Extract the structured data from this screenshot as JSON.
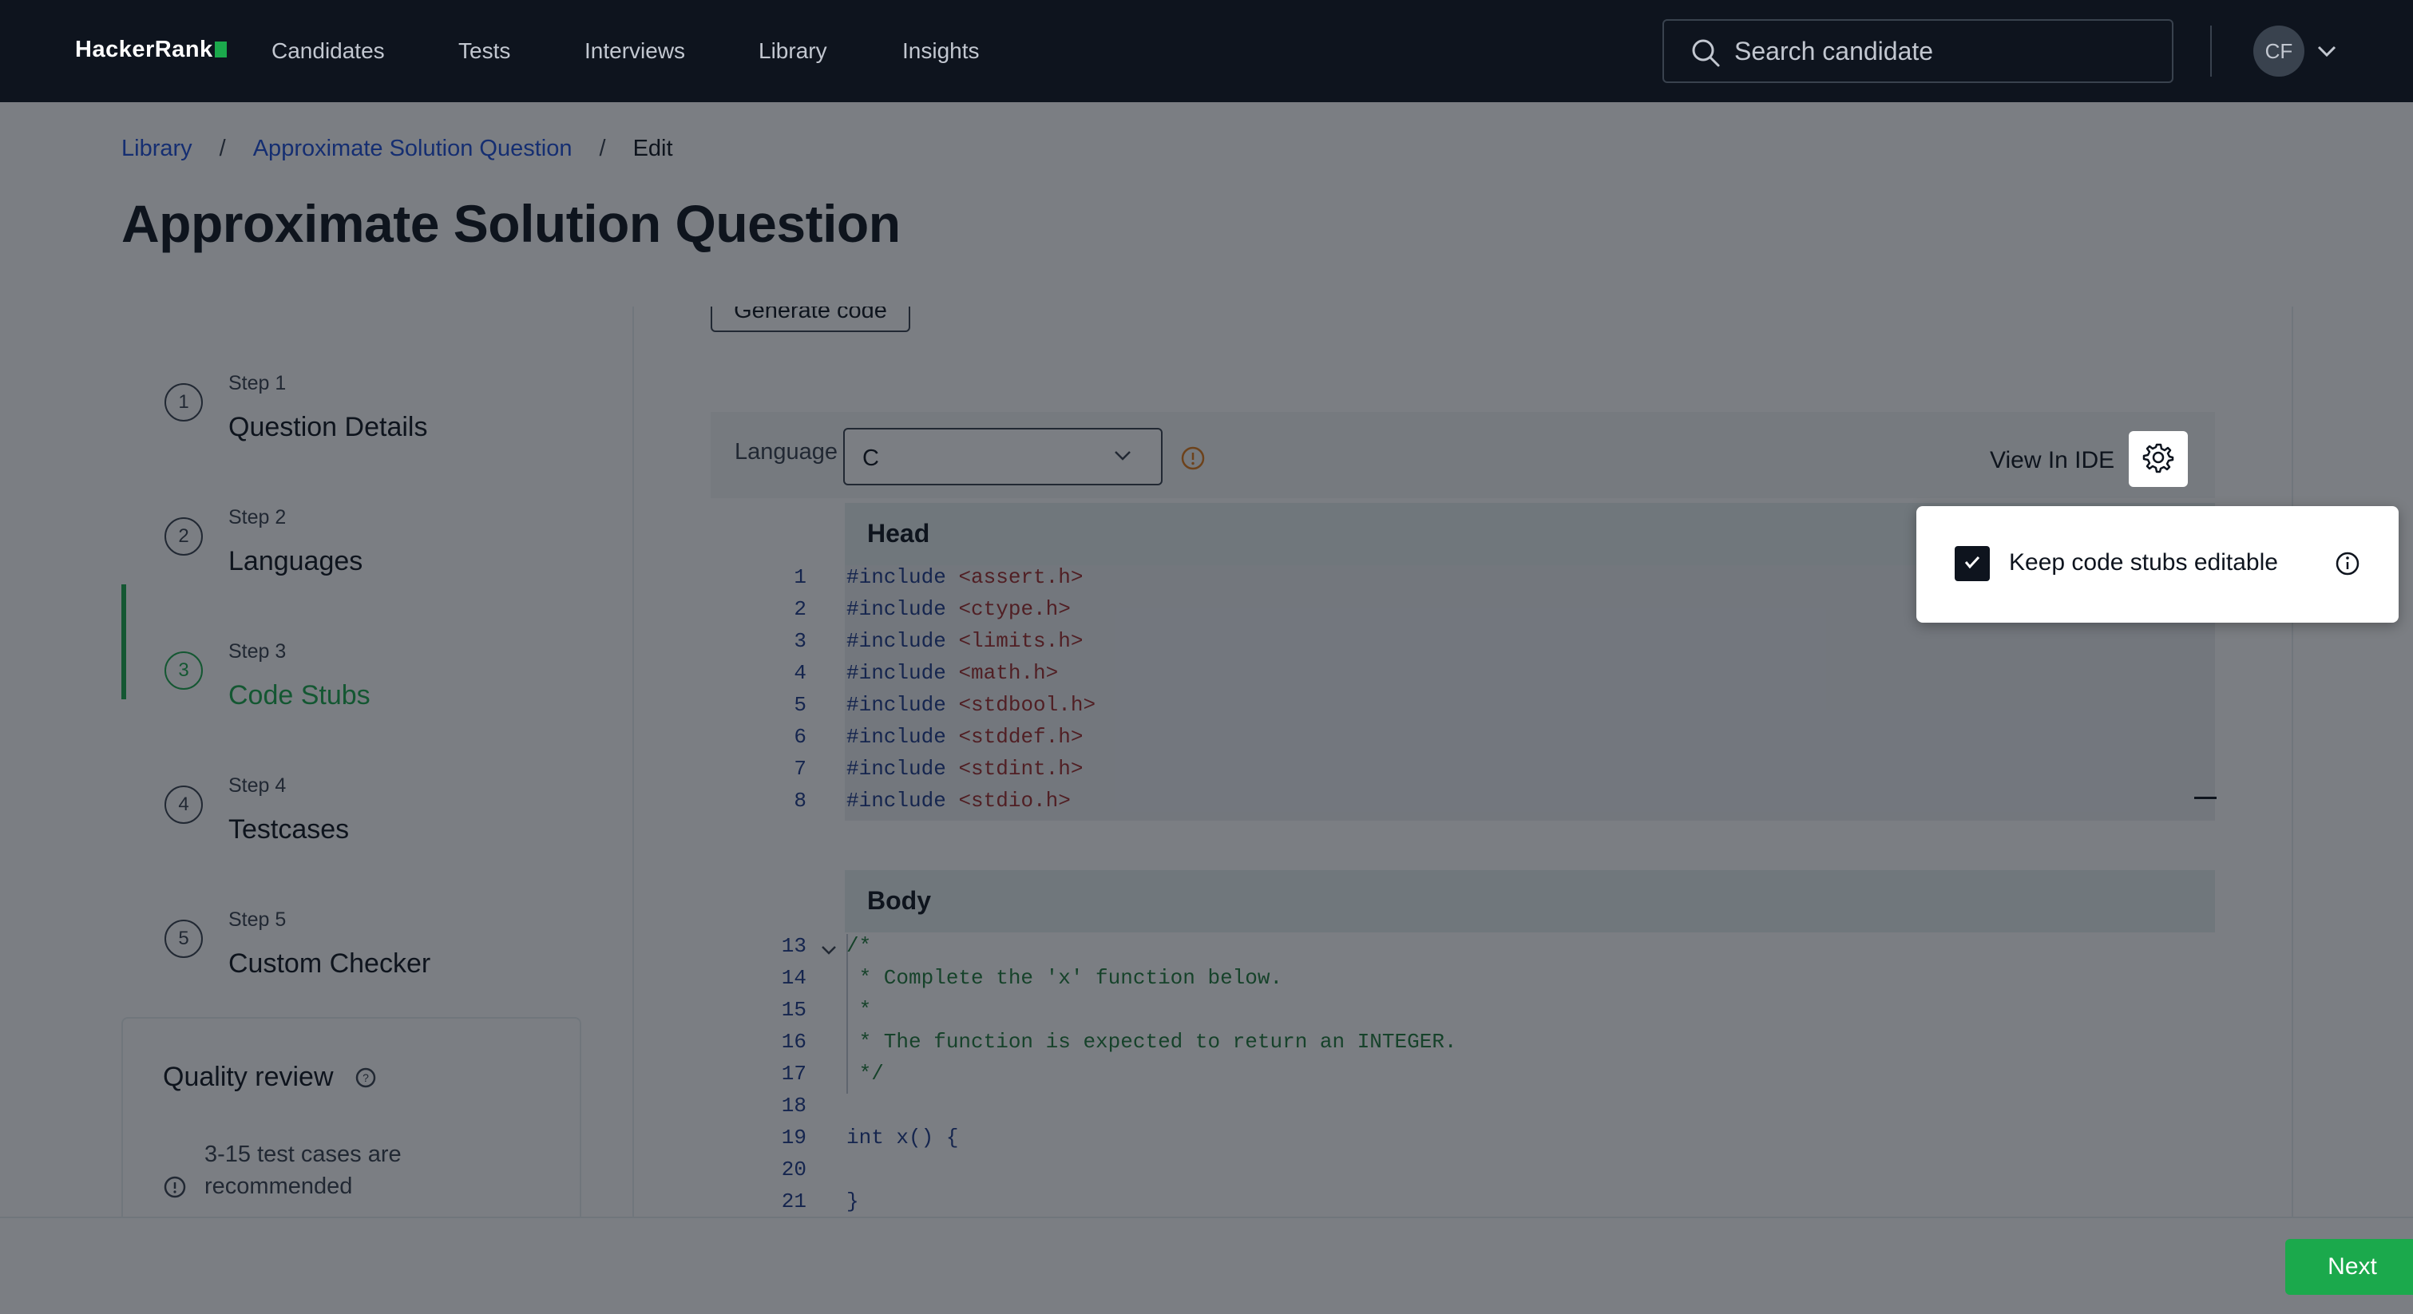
{
  "nav": {
    "logo": "HackerRank",
    "links": [
      "Candidates",
      "Tests",
      "Interviews",
      "Library",
      "Insights"
    ],
    "search_placeholder": "Search candidate",
    "avatar_initials": "CF",
    "colors": {
      "bg": "#0e141e",
      "brand": "#1ba94c"
    }
  },
  "breadcrumb": {
    "items": [
      "Library",
      "Approximate Solution Question",
      "Edit"
    ],
    "separator": "/"
  },
  "page_title": "Approximate Solution Question",
  "steps": [
    {
      "num": "1",
      "label": "Step 1",
      "title": "Question Details"
    },
    {
      "num": "2",
      "label": "Step 2",
      "title": "Languages"
    },
    {
      "num": "3",
      "label": "Step 3",
      "title": "Code Stubs"
    },
    {
      "num": "4",
      "label": "Step 4",
      "title": "Testcases"
    },
    {
      "num": "5",
      "label": "Step 5",
      "title": "Custom Checker"
    }
  ],
  "active_step": 3,
  "quality_review": {
    "title": "Quality review",
    "item": "3-15 test cases are recommended"
  },
  "editor": {
    "generate_button": "Generate code",
    "language_label": "Language",
    "language_value": "C",
    "view_in_ide": "View In IDE",
    "head_label": "Head",
    "body_label": "Body",
    "head_lines": [
      {
        "n": "1",
        "kw": "#include",
        "val": "<assert.h>"
      },
      {
        "n": "2",
        "kw": "#include",
        "val": "<ctype.h>"
      },
      {
        "n": "3",
        "kw": "#include",
        "val": "<limits.h>"
      },
      {
        "n": "4",
        "kw": "#include",
        "val": "<math.h>"
      },
      {
        "n": "5",
        "kw": "#include",
        "val": "<stdbool.h>"
      },
      {
        "n": "6",
        "kw": "#include",
        "val": "<stddef.h>"
      },
      {
        "n": "7",
        "kw": "#include",
        "val": "<stdint.h>"
      },
      {
        "n": "8",
        "kw": "#include",
        "val": "<stdio.h>"
      }
    ],
    "body_lines": [
      {
        "n": "13",
        "text": "/*"
      },
      {
        "n": "14",
        "text": " * Complete the 'x' function below."
      },
      {
        "n": "15",
        "text": " *"
      },
      {
        "n": "16",
        "text": " * The function is expected to return an INTEGER."
      },
      {
        "n": "17",
        "text": " */"
      },
      {
        "n": "18",
        "text": ""
      },
      {
        "n": "19",
        "text": "int x() {"
      },
      {
        "n": "20",
        "text": ""
      },
      {
        "n": "21",
        "text": "}"
      }
    ]
  },
  "popover": {
    "checkbox_label": "Keep code stubs editable",
    "checked": true
  },
  "footer": {
    "next": "Next"
  }
}
